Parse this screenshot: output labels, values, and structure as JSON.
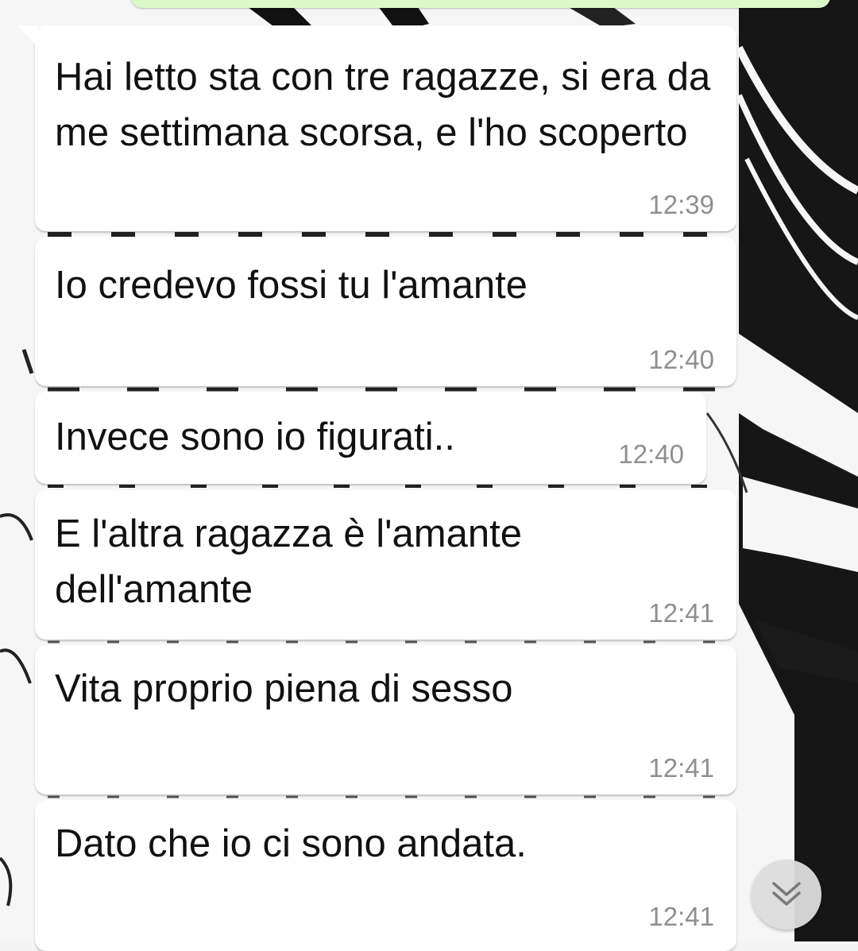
{
  "chat": {
    "messages": [
      {
        "text": "Hai letto sta con tre ragazze, si era da me settimana scorsa, e l'ho scoperto",
        "time": "12:39"
      },
      {
        "text": "Io credevo fossi tu l'amante",
        "time": "12:40"
      },
      {
        "text": "Invece sono io figurati..",
        "time": "12:40"
      },
      {
        "text": "E l'altra ragazza è l'amante dell'amante",
        "time": "12:41"
      },
      {
        "text": "Vita proprio piena di sesso",
        "time": "12:41"
      },
      {
        "text": "Dato che io ci sono andata.",
        "time": "12:41"
      }
    ]
  },
  "colors": {
    "incoming_bubble": "#ffffff",
    "outgoing_bubble": "#dcf8c6",
    "timestamp": "#8f8f8f",
    "message_text": "#111111"
  },
  "icons": {
    "scroll_down": "double-chevron-down-icon"
  }
}
